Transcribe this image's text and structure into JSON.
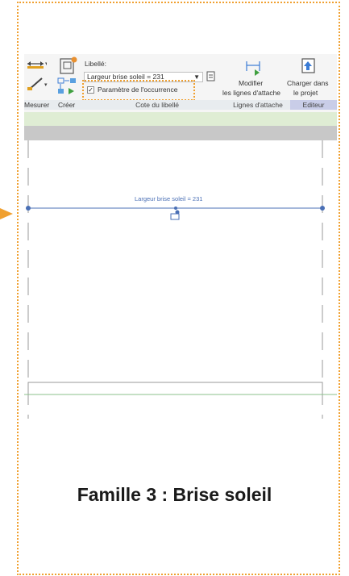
{
  "ribbon": {
    "libelle_label": "Libellé:",
    "libelle_value": "Largeur brise soleil = 231",
    "occurrence_label": "Paramètre de l'occurrence",
    "occurrence_checked": true,
    "mesurer_label": "Mesurer",
    "creer_label": "Créer",
    "modifier_label_1": "Modifier",
    "modifier_label_2": "les lignes d'attache",
    "charger_label_1": "Charger dans",
    "charger_label_2": "le projet",
    "panel_cote": "Cote du libellé",
    "panel_lignes": "Lignes d'attache",
    "panel_editeur": "Editeur"
  },
  "canvas": {
    "dimension_text": "Largeur brise soleil = 231"
  },
  "caption": "Famille 3 : Brise soleil",
  "colors": {
    "accent": "#f0a030",
    "dimension": "#4a6fb5"
  },
  "icons": [
    "measure-icon",
    "aligned-dimension-icon",
    "create-icon",
    "family-types-icon",
    "edit-witness-lines-icon",
    "load-into-project-icon",
    "dimension-label-icon"
  ]
}
